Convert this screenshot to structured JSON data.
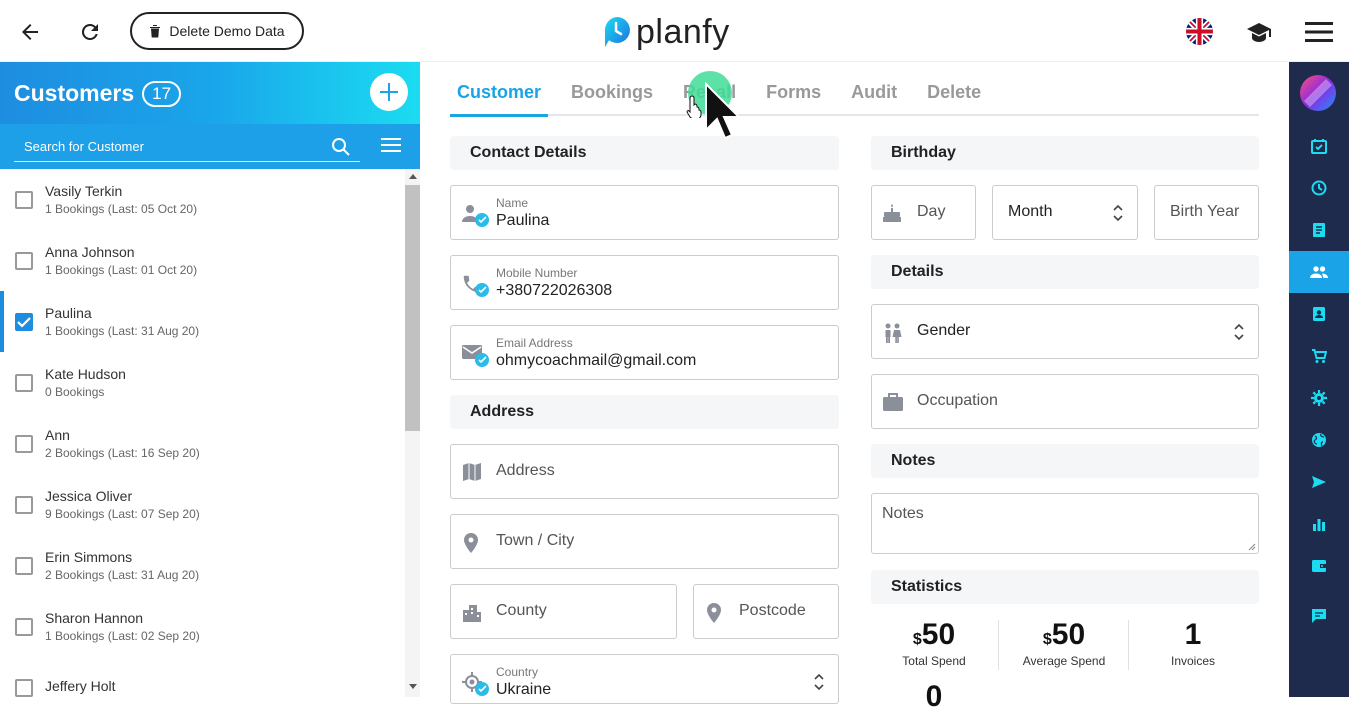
{
  "topbar": {
    "delete_demo_label": "Delete Demo Data",
    "brand": "planfy"
  },
  "customers": {
    "title": "Customers",
    "count": "17",
    "search_placeholder": "Search for Customer",
    "items": [
      {
        "name": "Vasily Terkin",
        "sub": "1 Bookings (Last: 05 Oct 20)",
        "checked": false
      },
      {
        "name": "Anna Johnson",
        "sub": "1 Bookings (Last: 01 Oct 20)",
        "checked": false
      },
      {
        "name": "Paulina",
        "sub": "1 Bookings (Last: 31 Aug 20)",
        "checked": true
      },
      {
        "name": "Kate Hudson",
        "sub": "0 Bookings",
        "checked": false
      },
      {
        "name": "Ann",
        "sub": "2 Bookings (Last: 16 Sep 20)",
        "checked": false
      },
      {
        "name": "Jessica Oliver",
        "sub": "9 Bookings (Last: 07 Sep 20)",
        "checked": false
      },
      {
        "name": "Erin Simmons",
        "sub": "2 Bookings (Last: 31 Aug 20)",
        "checked": false
      },
      {
        "name": "Sharon Hannon",
        "sub": "1 Bookings (Last: 02 Sep 20)",
        "checked": false
      },
      {
        "name": "Jeffery Holt",
        "sub": "",
        "checked": false
      }
    ]
  },
  "tabs": [
    "Customer",
    "Bookings",
    "Recall",
    "Forms",
    "Audit",
    "Delete"
  ],
  "contact": {
    "heading": "Contact Details",
    "name_label": "Name",
    "name_value": "Paulina",
    "mobile_label": "Mobile Number",
    "mobile_value": "+380722026308",
    "email_label": "Email Address",
    "email_value": "ohmycoachmail@gmail.com"
  },
  "address": {
    "heading": "Address",
    "address_ph": "Address",
    "town_ph": "Town / City",
    "county_ph": "County",
    "postcode_ph": "Postcode",
    "country_label": "Country",
    "country_value": "Ukraine"
  },
  "birthday": {
    "heading": "Birthday",
    "day_ph": "Day",
    "month_ph": "Month",
    "year_ph": "Birth Year"
  },
  "details": {
    "heading": "Details",
    "gender_ph": "Gender",
    "occupation_ph": "Occupation"
  },
  "notes": {
    "heading": "Notes",
    "notes_ph": "Notes"
  },
  "statistics": {
    "heading": "Statistics",
    "total_spend_currency": "$",
    "total_spend_value": "50",
    "total_spend_caption": "Total Spend",
    "avg_spend_currency": "$",
    "avg_spend_value": "50",
    "avg_spend_caption": "Average Spend",
    "invoices_value": "1",
    "invoices_caption": "Invoices",
    "fourth_value": "0"
  },
  "colors": {
    "accent": "#1ba3e8",
    "rail": "#1e2b4d"
  }
}
